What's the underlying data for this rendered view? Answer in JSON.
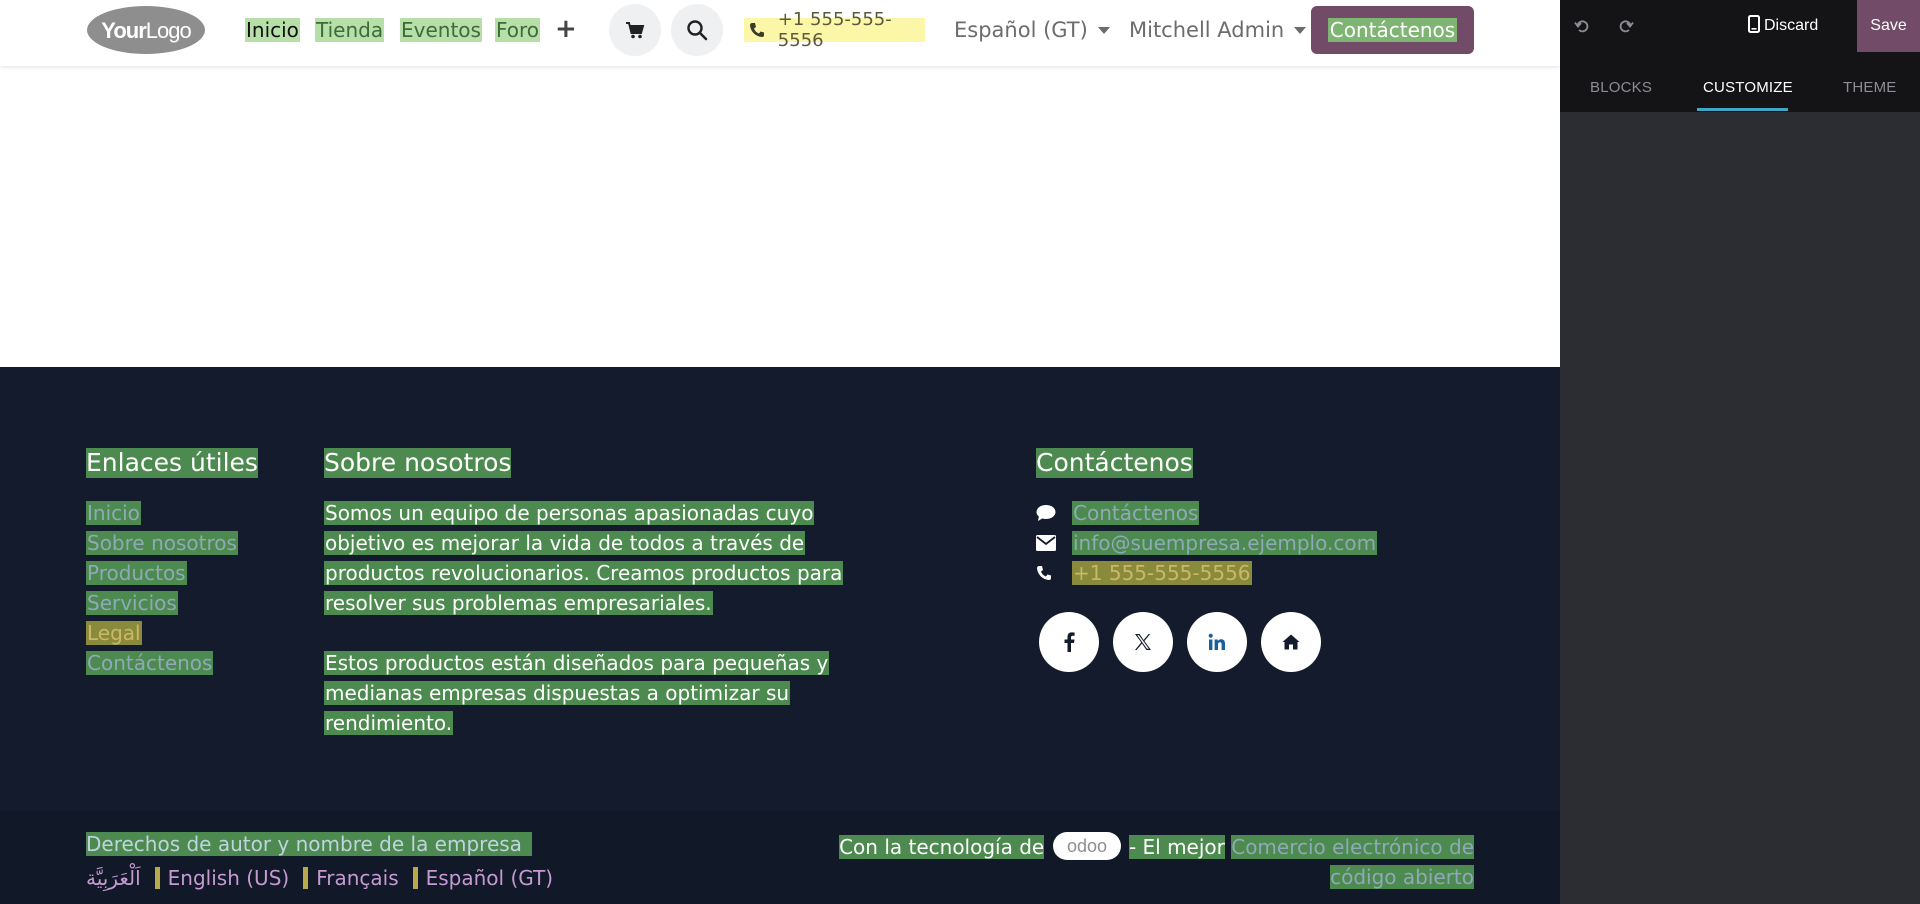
{
  "header": {
    "logo_text": "YourLogo",
    "nav": [
      "Inicio",
      "Tienda",
      "Eventos",
      "Foro"
    ],
    "phone": "+1 555-555-5556",
    "language": "Español (GT)",
    "user": "Mitchell Admin",
    "contact_button": "Contáctenos"
  },
  "footer": {
    "useful_links": {
      "title": "Enlaces útiles",
      "items": [
        "Inicio",
        "Sobre nosotros",
        "Productos",
        "Servicios",
        "Legal",
        "Contáctenos"
      ]
    },
    "about": {
      "title": "Sobre nosotros",
      "paragraph1": "Somos un equipo de personas apasionadas cuyo objetivo es mejorar la vida de todos a través de productos revolucionarios. Creamos productos para resolver sus problemas empresariales.",
      "paragraph2": "Estos productos están diseñados para pequeñas y medianas empresas dispuestas a optimizar su rendimiento."
    },
    "contact": {
      "title": "Contáctenos",
      "link": "Contáctenos",
      "email": "info@suempresa.ejemplo.com",
      "phone": "+1 555-555-5556"
    },
    "socials": [
      "facebook-icon",
      "x-icon",
      "linkedin-icon",
      "home-icon"
    ]
  },
  "copyright": {
    "text": "Derechos de autor y nombre de la empresa",
    "languages": [
      "اَلْعَرَبِيَّة",
      "English (US)",
      "Français",
      "Español (GT)"
    ],
    "powered_prefix": "Con la tecnología de",
    "powered_brand": "odoo",
    "powered_middle": "- El mejor",
    "powered_link": "Comercio electrónico de código abierto"
  },
  "editor": {
    "discard": "Discard",
    "save": "Save",
    "tabs": [
      "BLOCKS",
      "CUSTOMIZE",
      "THEME"
    ],
    "active_tab": "CUSTOMIZE"
  },
  "colors": {
    "brand": "#714b67",
    "footer_bg": "#141b2d",
    "highlight_green": "#4d8a4f",
    "panel_bg": "#2c2c33",
    "tab_accent": "#40a6c4"
  }
}
